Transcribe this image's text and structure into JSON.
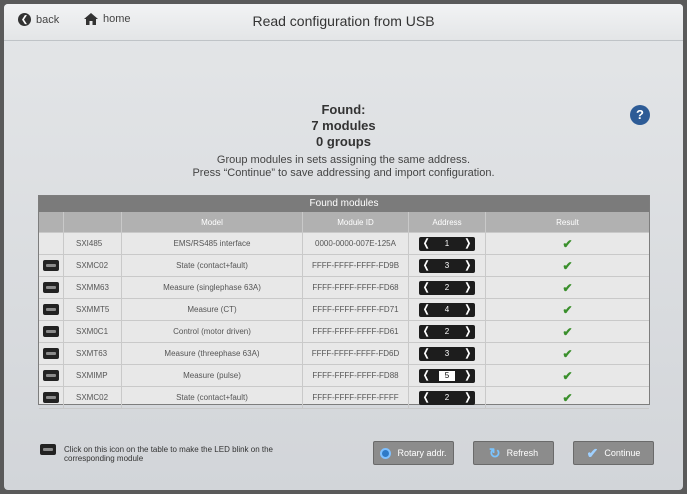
{
  "header": {
    "back_label": "back",
    "home_label": "home",
    "title": "Read configuration from USB"
  },
  "found": {
    "line1": "Found:",
    "line2": "7 modules",
    "line3": "0 groups"
  },
  "help_label": "?",
  "instructions": {
    "line1": "Group modules in sets assigning the same address.",
    "line2": "Press “Continue” to save addressing and import configuration."
  },
  "table": {
    "caption": "Found modules",
    "columns": [
      "",
      "Model",
      "Module ID",
      "Address",
      "Result"
    ],
    "rows": [
      {
        "led": false,
        "code": "SXI485",
        "model": "EMS/RS485 interface",
        "id": "0000-0000-007E-125A",
        "address": "1",
        "result": "✔"
      },
      {
        "led": true,
        "code": "SXMC02",
        "model": "State (contact+fault)",
        "id": "FFFF-FFFF-FFFF-FD9B",
        "address": "3",
        "result": "✔"
      },
      {
        "led": true,
        "code": "SXMM63",
        "model": "Measure (singlephase 63A)",
        "id": "FFFF-FFFF-FFFF-FD68",
        "address": "2",
        "result": "✔"
      },
      {
        "led": true,
        "code": "SXMMT5",
        "model": "Measure (CT)",
        "id": "FFFF-FFFF-FFFF-FD71",
        "address": "4",
        "result": "✔"
      },
      {
        "led": true,
        "code": "SXM0C1",
        "model": "Control (motor driven)",
        "id": "FFFF-FFFF-FFFF-FD61",
        "address": "2",
        "result": "✔"
      },
      {
        "led": true,
        "code": "SXMT63",
        "model": "Measure (threephase 63A)",
        "id": "FFFF-FFFF-FFFF-FD6D",
        "address": "3",
        "result": "✔"
      },
      {
        "led": true,
        "code": "SXMIMP",
        "model": "Measure (pulse)",
        "id": "FFFF-FFFF-FFFF-FD88",
        "address": "5",
        "result": "✔"
      },
      {
        "led": true,
        "code": "SXMC02",
        "model": "State (contact+fault)",
        "id": "FFFF-FFFF-FFFF-FFFF",
        "address": "2",
        "result": "✔"
      }
    ]
  },
  "legend_text": "Click on this icon on the table to make the LED blink on the corresponding module",
  "buttons": {
    "rotary": "Rotary addr.",
    "refresh": "Refresh",
    "continue": "Continue"
  }
}
